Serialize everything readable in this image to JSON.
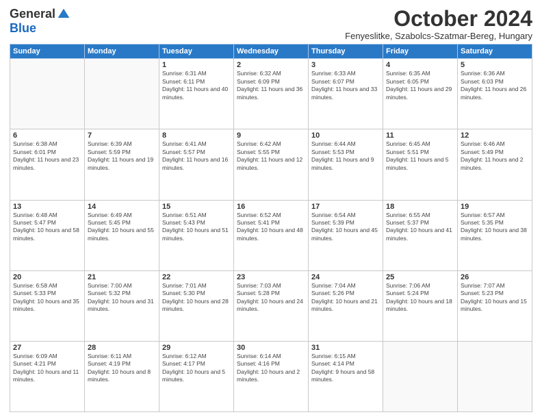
{
  "logo": {
    "general": "General",
    "blue": "Blue"
  },
  "title": "October 2024",
  "location": "Fenyeslitke, Szabolcs-Szatmar-Bereg, Hungary",
  "days_of_week": [
    "Sunday",
    "Monday",
    "Tuesday",
    "Wednesday",
    "Thursday",
    "Friday",
    "Saturday"
  ],
  "weeks": [
    [
      {
        "day": "",
        "info": ""
      },
      {
        "day": "",
        "info": ""
      },
      {
        "day": "1",
        "info": "Sunrise: 6:31 AM\nSunset: 6:11 PM\nDaylight: 11 hours and 40 minutes."
      },
      {
        "day": "2",
        "info": "Sunrise: 6:32 AM\nSunset: 6:09 PM\nDaylight: 11 hours and 36 minutes."
      },
      {
        "day": "3",
        "info": "Sunrise: 6:33 AM\nSunset: 6:07 PM\nDaylight: 11 hours and 33 minutes."
      },
      {
        "day": "4",
        "info": "Sunrise: 6:35 AM\nSunset: 6:05 PM\nDaylight: 11 hours and 29 minutes."
      },
      {
        "day": "5",
        "info": "Sunrise: 6:36 AM\nSunset: 6:03 PM\nDaylight: 11 hours and 26 minutes."
      }
    ],
    [
      {
        "day": "6",
        "info": "Sunrise: 6:38 AM\nSunset: 6:01 PM\nDaylight: 11 hours and 23 minutes."
      },
      {
        "day": "7",
        "info": "Sunrise: 6:39 AM\nSunset: 5:59 PM\nDaylight: 11 hours and 19 minutes."
      },
      {
        "day": "8",
        "info": "Sunrise: 6:41 AM\nSunset: 5:57 PM\nDaylight: 11 hours and 16 minutes."
      },
      {
        "day": "9",
        "info": "Sunrise: 6:42 AM\nSunset: 5:55 PM\nDaylight: 11 hours and 12 minutes."
      },
      {
        "day": "10",
        "info": "Sunrise: 6:44 AM\nSunset: 5:53 PM\nDaylight: 11 hours and 9 minutes."
      },
      {
        "day": "11",
        "info": "Sunrise: 6:45 AM\nSunset: 5:51 PM\nDaylight: 11 hours and 5 minutes."
      },
      {
        "day": "12",
        "info": "Sunrise: 6:46 AM\nSunset: 5:49 PM\nDaylight: 11 hours and 2 minutes."
      }
    ],
    [
      {
        "day": "13",
        "info": "Sunrise: 6:48 AM\nSunset: 5:47 PM\nDaylight: 10 hours and 58 minutes."
      },
      {
        "day": "14",
        "info": "Sunrise: 6:49 AM\nSunset: 5:45 PM\nDaylight: 10 hours and 55 minutes."
      },
      {
        "day": "15",
        "info": "Sunrise: 6:51 AM\nSunset: 5:43 PM\nDaylight: 10 hours and 51 minutes."
      },
      {
        "day": "16",
        "info": "Sunrise: 6:52 AM\nSunset: 5:41 PM\nDaylight: 10 hours and 48 minutes."
      },
      {
        "day": "17",
        "info": "Sunrise: 6:54 AM\nSunset: 5:39 PM\nDaylight: 10 hours and 45 minutes."
      },
      {
        "day": "18",
        "info": "Sunrise: 6:55 AM\nSunset: 5:37 PM\nDaylight: 10 hours and 41 minutes."
      },
      {
        "day": "19",
        "info": "Sunrise: 6:57 AM\nSunset: 5:35 PM\nDaylight: 10 hours and 38 minutes."
      }
    ],
    [
      {
        "day": "20",
        "info": "Sunrise: 6:58 AM\nSunset: 5:33 PM\nDaylight: 10 hours and 35 minutes."
      },
      {
        "day": "21",
        "info": "Sunrise: 7:00 AM\nSunset: 5:32 PM\nDaylight: 10 hours and 31 minutes."
      },
      {
        "day": "22",
        "info": "Sunrise: 7:01 AM\nSunset: 5:30 PM\nDaylight: 10 hours and 28 minutes."
      },
      {
        "day": "23",
        "info": "Sunrise: 7:03 AM\nSunset: 5:28 PM\nDaylight: 10 hours and 24 minutes."
      },
      {
        "day": "24",
        "info": "Sunrise: 7:04 AM\nSunset: 5:26 PM\nDaylight: 10 hours and 21 minutes."
      },
      {
        "day": "25",
        "info": "Sunrise: 7:06 AM\nSunset: 5:24 PM\nDaylight: 10 hours and 18 minutes."
      },
      {
        "day": "26",
        "info": "Sunrise: 7:07 AM\nSunset: 5:23 PM\nDaylight: 10 hours and 15 minutes."
      }
    ],
    [
      {
        "day": "27",
        "info": "Sunrise: 6:09 AM\nSunset: 4:21 PM\nDaylight: 10 hours and 11 minutes."
      },
      {
        "day": "28",
        "info": "Sunrise: 6:11 AM\nSunset: 4:19 PM\nDaylight: 10 hours and 8 minutes."
      },
      {
        "day": "29",
        "info": "Sunrise: 6:12 AM\nSunset: 4:17 PM\nDaylight: 10 hours and 5 minutes."
      },
      {
        "day": "30",
        "info": "Sunrise: 6:14 AM\nSunset: 4:16 PM\nDaylight: 10 hours and 2 minutes."
      },
      {
        "day": "31",
        "info": "Sunrise: 6:15 AM\nSunset: 4:14 PM\nDaylight: 9 hours and 58 minutes."
      },
      {
        "day": "",
        "info": ""
      },
      {
        "day": "",
        "info": ""
      }
    ]
  ]
}
